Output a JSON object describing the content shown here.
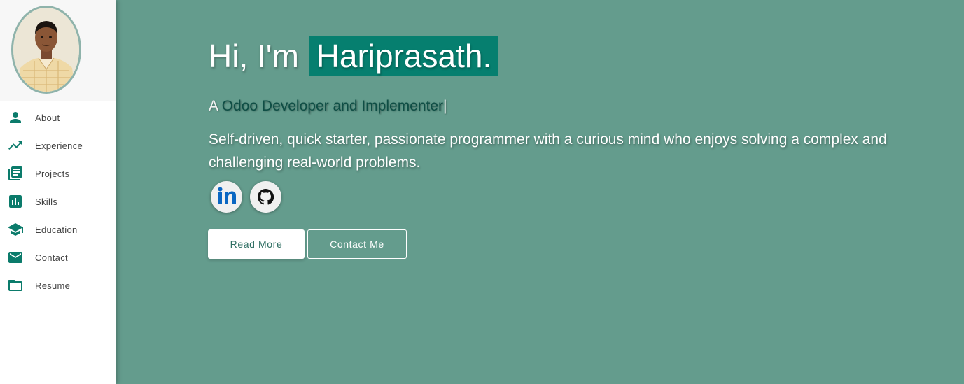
{
  "sidebar": {
    "items": [
      {
        "label": "About",
        "icon": "person-icon"
      },
      {
        "label": "Experience",
        "icon": "trending-up-icon"
      },
      {
        "label": "Projects",
        "icon": "library-books-icon"
      },
      {
        "label": "Skills",
        "icon": "bar-chart-icon"
      },
      {
        "label": "Education",
        "icon": "school-icon"
      },
      {
        "label": "Contact",
        "icon": "mail-icon"
      },
      {
        "label": "Resume",
        "icon": "folder-icon"
      }
    ]
  },
  "hero": {
    "greeting": "Hi, I'm",
    "name": "Hariprasath.",
    "role_prefix": "A",
    "role": "Odoo Developer and Implementer",
    "cursor": "|",
    "bio": "Self-driven, quick starter, passionate programmer with a curious mind who enjoys solving a complex and challenging real-world problems."
  },
  "social": [
    {
      "name": "LinkedIn",
      "icon": "linkedin-icon"
    },
    {
      "name": "GitHub",
      "icon": "github-icon"
    }
  ],
  "buttons": {
    "read_more": "Read More",
    "contact_me": "Contact Me"
  },
  "colors": {
    "accent": "#067f6f",
    "background": "#649c8d",
    "icon": "#0b7b6b"
  }
}
